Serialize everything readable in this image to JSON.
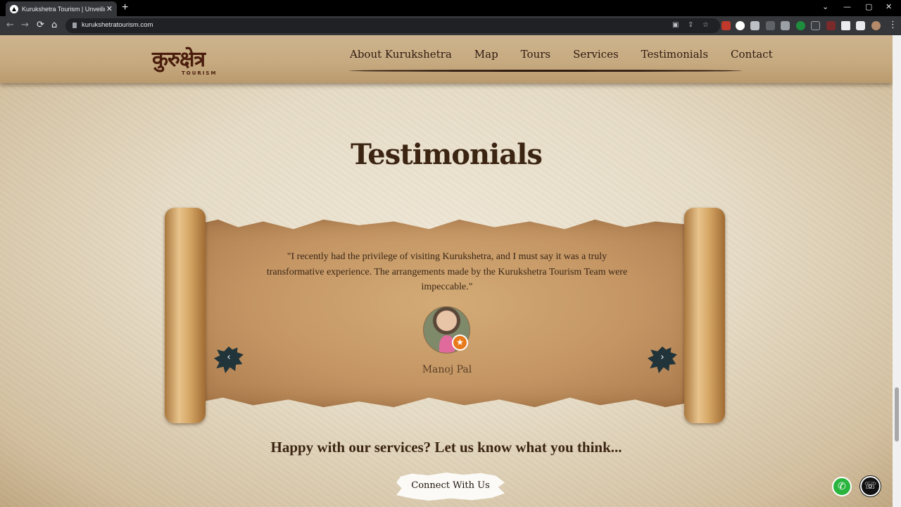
{
  "browser": {
    "tab_title": "Kurukshetra Tourism | Unveiling t",
    "tab_close": "✕",
    "new_tab": "+",
    "url": "kurukshetratourism.com",
    "back": "←",
    "forward": "→",
    "reload": "⟳",
    "home": "⌂",
    "win_down": "⌄",
    "win_min": "—",
    "win_max": "▢",
    "win_close": "✕",
    "menu": "⋮"
  },
  "header": {
    "logo_main": "कुरुक्षेत्र",
    "logo_sub": "TOURISM",
    "nav": [
      "About Kurukshetra",
      "Map",
      "Tours",
      "Services",
      "Testimonials",
      "Contact"
    ]
  },
  "section": {
    "title": "Testimonials"
  },
  "testimonial": {
    "quote": "\"I recently had the privilege of visiting Kurukshetra, and I must say it was a truly transformative experience. The arrangements made by the Kurukshetra Tourism Team were impeccable.\"",
    "author": "Manoj Pal",
    "badge": "★",
    "prev": "‹",
    "next": "›"
  },
  "cta": {
    "text": "Happy with our services? Let us know what you think...",
    "button": "Connect With Us"
  },
  "floating": {
    "whatsapp": "✆",
    "call": "☏"
  },
  "colors": {
    "heading": "#3b2412",
    "parchment": "#c49563",
    "arrow_blot": "#21343a",
    "whatsapp": "#29b43e"
  }
}
